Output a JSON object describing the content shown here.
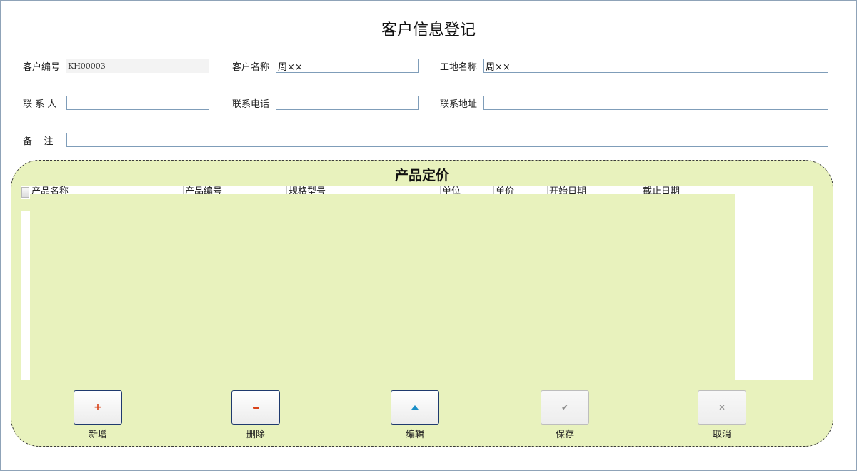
{
  "form": {
    "title": "客户信息登记",
    "fields": {
      "customer_id": {
        "label": "客户编号",
        "value": "KH00003"
      },
      "customer_name": {
        "label": "客户名称",
        "value": "周××"
      },
      "site_name": {
        "label": "工地名称",
        "value": "周××"
      },
      "contact_person": {
        "label": "联 系 人",
        "value": ""
      },
      "contact_phone": {
        "label": "联系电话",
        "value": ""
      },
      "contact_address": {
        "label": "联系地址",
        "value": ""
      },
      "remarks": {
        "label": "备    注",
        "value": ""
      }
    }
  },
  "pricing": {
    "title": "产品定价",
    "columns": [
      "产品名称",
      "产品编号",
      "规格型号",
      "单位",
      "单价",
      "开始日期",
      "截止日期"
    ]
  },
  "toolbar": {
    "add": {
      "label": "新增",
      "icon": "plus-icon",
      "enabled": true
    },
    "delete": {
      "label": "删除",
      "icon": "minus-icon",
      "enabled": true
    },
    "edit": {
      "label": "编辑",
      "icon": "up-arrow-icon",
      "enabled": true
    },
    "save": {
      "label": "保存",
      "icon": "check-icon",
      "enabled": false
    },
    "cancel": {
      "label": "取消",
      "icon": "close-icon",
      "enabled": false
    }
  },
  "colors": {
    "panel_bg": "#e8f2bd",
    "input_border": "#7f9db9",
    "accent_red": "#d8431a",
    "accent_blue": "#1b8fc7"
  }
}
